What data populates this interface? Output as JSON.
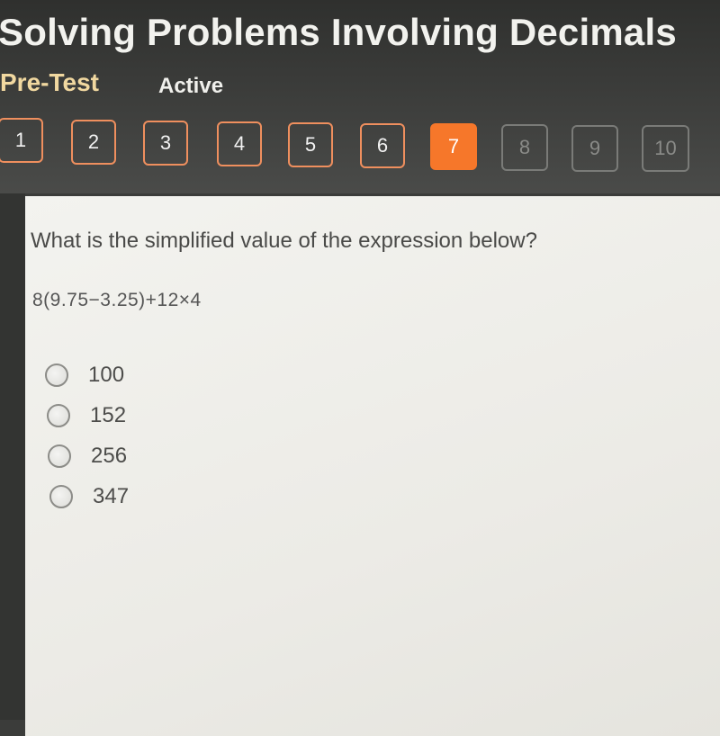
{
  "header": {
    "title": "Solving Problems Involving Decimals",
    "test_type": "Pre-Test",
    "status": "Active"
  },
  "question_nav": [
    {
      "label": "1",
      "state": "answered"
    },
    {
      "label": "2",
      "state": "answered"
    },
    {
      "label": "3",
      "state": "answered"
    },
    {
      "label": "4",
      "state": "answered"
    },
    {
      "label": "5",
      "state": "answered"
    },
    {
      "label": "6",
      "state": "answered"
    },
    {
      "label": "7",
      "state": "current"
    },
    {
      "label": "8",
      "state": "locked"
    },
    {
      "label": "9",
      "state": "locked"
    },
    {
      "label": "10",
      "state": "locked"
    }
  ],
  "question": {
    "prompt": "What is the simplified value of the expression below?",
    "expression": "8(9.75−3.25)+12×4",
    "options": [
      {
        "label": "100",
        "selected": false
      },
      {
        "label": "152",
        "selected": false
      },
      {
        "label": "256",
        "selected": false
      },
      {
        "label": "347",
        "selected": false
      }
    ]
  },
  "colors": {
    "accent": "#f6772a",
    "nav_border": "#ef8f5e",
    "header_bg": "#3b3c3a",
    "panel_bg": "#efeee9"
  }
}
